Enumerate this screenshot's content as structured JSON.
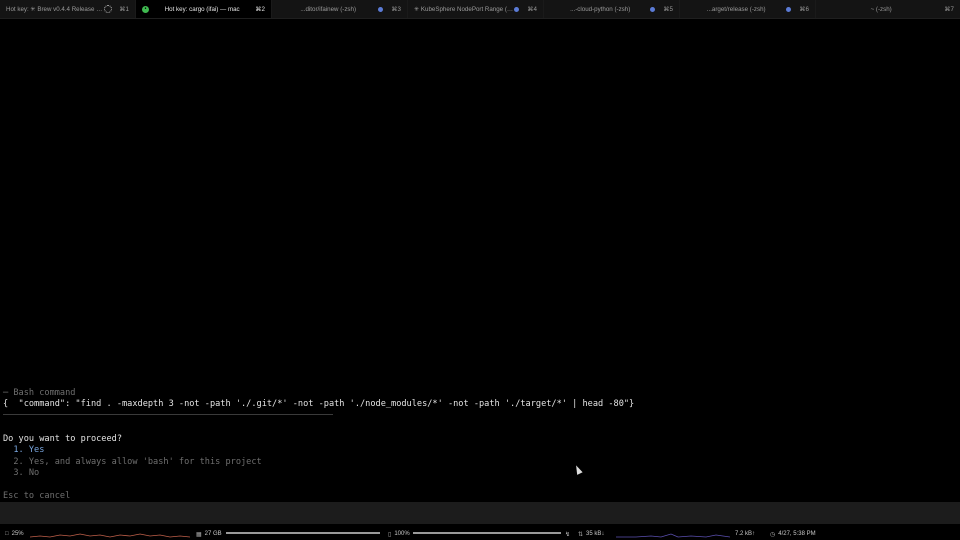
{
  "tabs": [
    {
      "title": "Hot key: ✳ Brew v0.4.4 Release (nod...",
      "shortcut": "⌘1",
      "active": false,
      "indicator": "spinner"
    },
    {
      "title": "Hot key: cargo (ifai) — mac",
      "shortcut": "⌘2",
      "active": true,
      "indicator": "green-dot"
    },
    {
      "title": "...ditor/ifainew (-zsh)",
      "shortcut": "⌘3",
      "active": false,
      "indicator": "blue-dot"
    },
    {
      "title": "✳ KubeSphere NodePort Range (no...",
      "shortcut": "⌘4",
      "active": false,
      "indicator": "blue-dot"
    },
    {
      "title": "...-cloud-python (-zsh)",
      "shortcut": "⌘5",
      "active": false,
      "indicator": "blue-dot"
    },
    {
      "title": "...arget/release (-zsh)",
      "shortcut": "⌘6",
      "active": false,
      "indicator": "blue-dot"
    },
    {
      "title": "~ (-zsh)",
      "shortcut": "⌘7",
      "active": false,
      "indicator": "none"
    }
  ],
  "terminal": {
    "section_header": "─ Bash command",
    "command_text": "{  \"command\": \"find . -maxdepth 3 -not -path './.git/*' -not -path './node_modules/*' -not -path './target/*' | head -80\"}",
    "question": "Do you want to proceed?",
    "options": [
      {
        "label": "  1. Yes",
        "selected": true
      },
      {
        "label": "  2. Yes, and always allow 'bash' for this project",
        "selected": false
      },
      {
        "label": "  3. No",
        "selected": false
      }
    ],
    "cancel_hint": "Esc to cancel"
  },
  "status": {
    "cpu": "25%",
    "memory": "27 GB",
    "battery": "100%",
    "download": "35 kB↓",
    "upload": "7.2 kB↑",
    "datetime": "4/27, 5:38 PM"
  },
  "colors": {
    "background": "#000000",
    "selected_option": "#7aa7e0",
    "dim_text": "#6f6f6f",
    "cpu_graph": "#c0604a",
    "network_graph": "#5a4fb0"
  }
}
